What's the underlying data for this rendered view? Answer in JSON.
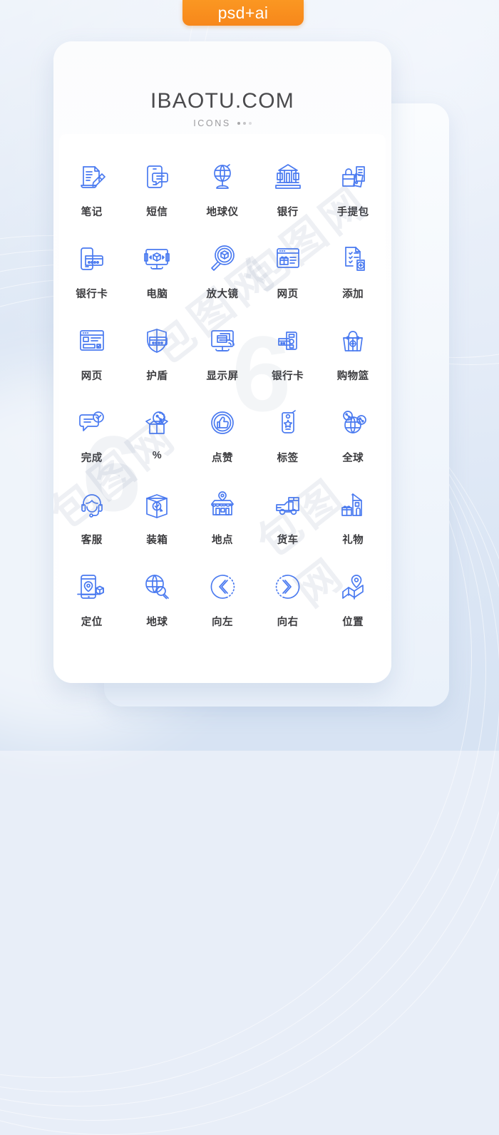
{
  "tag": {
    "label": "psd+ai",
    "color": "#f7871b"
  },
  "card": {
    "brand": "IBAOTU.COM",
    "subtitle": "ICONS",
    "icon_color": "#4a7af0"
  },
  "grid": {
    "columns": 5,
    "rows": 6,
    "items": [
      {
        "label": "笔记",
        "icon": "note-pencil-icon"
      },
      {
        "label": "短信",
        "icon": "sms-tablet-icon"
      },
      {
        "label": "地球仪",
        "icon": "globe-stand-icon"
      },
      {
        "label": "银行",
        "icon": "bank-building-icon"
      },
      {
        "label": "手提包",
        "icon": "handbag-documents-icon"
      },
      {
        "label": "银行卡",
        "icon": "phone-bankcard-icon"
      },
      {
        "label": "电脑",
        "icon": "monitor-box-icon"
      },
      {
        "label": "放大镜",
        "icon": "magnifier-box-icon"
      },
      {
        "label": "网页",
        "icon": "webpage-gift-icon"
      },
      {
        "label": "添加",
        "icon": "checklist-add-icon"
      },
      {
        "label": "网页",
        "icon": "webpage-check-icon"
      },
      {
        "label": "护盾",
        "icon": "shield-card-icon"
      },
      {
        "label": "显示屏",
        "icon": "monitor-card-wifi-icon"
      },
      {
        "label": "银行卡",
        "icon": "card-terminal-icon"
      },
      {
        "label": "购物篮",
        "icon": "shopping-basket-icon"
      },
      {
        "label": "完成",
        "icon": "chat-check-icon"
      },
      {
        "label": "%",
        "icon": "open-box-percent-icon"
      },
      {
        "label": "点赞",
        "icon": "thumbs-up-badge-icon"
      },
      {
        "label": "标签",
        "icon": "tag-star-icon"
      },
      {
        "label": "全球",
        "icon": "global-percent-icon"
      },
      {
        "label": "客服",
        "icon": "headset-support-icon"
      },
      {
        "label": "装箱",
        "icon": "package-check-icon"
      },
      {
        "label": "地点",
        "icon": "store-pin-icon"
      },
      {
        "label": "货车",
        "icon": "delivery-truck-icon"
      },
      {
        "label": "礼物",
        "icon": "house-gift-icon"
      },
      {
        "label": "定位",
        "icon": "phone-pin-box-icon"
      },
      {
        "label": "地球",
        "icon": "globe-search-icon"
      },
      {
        "label": "向左",
        "icon": "chevron-left-circle-icon"
      },
      {
        "label": "向右",
        "icon": "chevron-right-circle-icon"
      },
      {
        "label": "位置",
        "icon": "map-pin-icon"
      }
    ]
  },
  "watermark": {
    "text": "包图网",
    "mark": "6"
  }
}
